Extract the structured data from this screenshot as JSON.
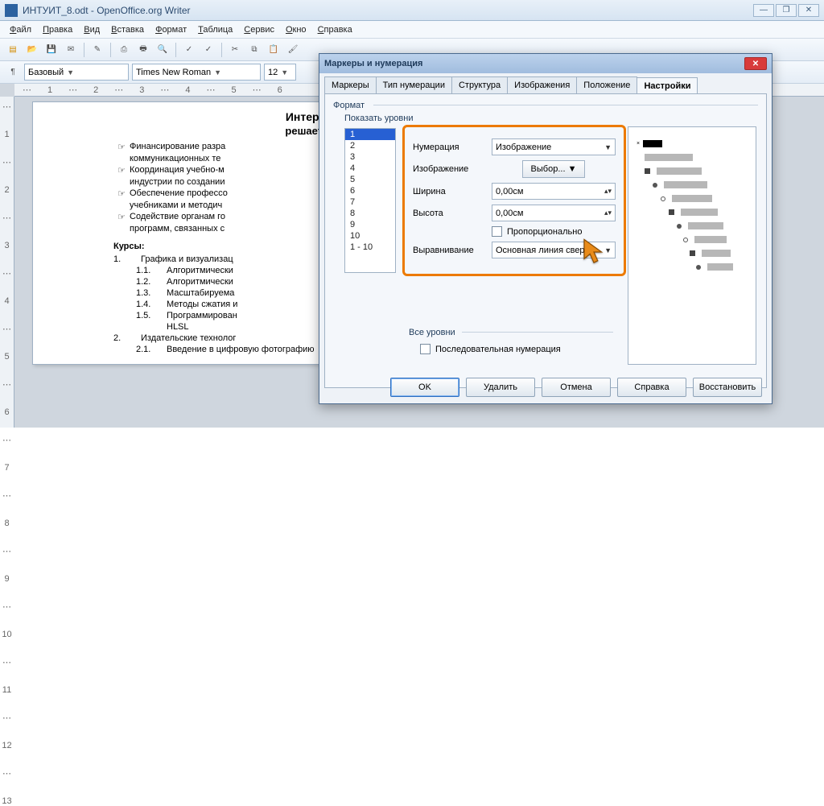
{
  "window": {
    "title": "ИНТУИТ_8.odt - OpenOffice.org Writer"
  },
  "menu": {
    "file": "Файл",
    "edit": "Правка",
    "view": "Вид",
    "insert": "Вставка",
    "format": "Формат",
    "table": "Таблица",
    "tools": "Сервис",
    "window": "Окно",
    "help": "Справка"
  },
  "toolbar2": {
    "style": "Базовый",
    "font": "Times New Roman",
    "size": "12"
  },
  "ruler_h": [
    "⋯",
    "1",
    "⋯",
    "2",
    "⋯",
    "3",
    "⋯",
    "4",
    "⋯",
    "5",
    "⋯",
    "6"
  ],
  "ruler_v": [
    "⋯",
    "1",
    "⋯",
    "2",
    "⋯",
    "3",
    "⋯",
    "4",
    "⋯",
    "5",
    "⋯",
    "6",
    "⋯",
    "7",
    "⋯",
    "8",
    "⋯",
    "9",
    "⋯",
    "10",
    "⋯",
    "11",
    "⋯",
    "12",
    "⋯",
    "13"
  ],
  "doc": {
    "h1": "Интернет-Университе",
    "h2": "решает следующие зад",
    "bullets": [
      "Финансирование разра",
      "коммуникационных те",
      "Координация учебно-м",
      "индустрии по создании",
      "Обеспечение профессо",
      "учебниками и методич",
      "Содействие органам го",
      "программ, связанных с"
    ],
    "kursy": "Курсы:",
    "nums": [
      {
        "n": "1.",
        "t": "Графика и визуализац"
      },
      {
        "n": "1.1.",
        "t": "Алгоритмически"
      },
      {
        "n": "1.2.",
        "t": "Алгоритмически"
      },
      {
        "n": "1.3.",
        "t": "Масштабируема"
      },
      {
        "n": "1.4.",
        "t": "Методы сжатия и"
      },
      {
        "n": "1.5.",
        "t": "Программирован"
      },
      {
        "n": "",
        "t": "HLSL"
      },
      {
        "n": "2.",
        "t": "Издательские технолог"
      },
      {
        "n": "2.1.",
        "t": "Введение в цифровую фотографию"
      }
    ],
    "bullet_glyph": "☞"
  },
  "dialog": {
    "title": "Маркеры и нумерация",
    "tabs": [
      "Маркеры",
      "Тип нумерации",
      "Структура",
      "Изображения",
      "Положение",
      "Настройки"
    ],
    "active_tab": 5,
    "format_label": "Формат",
    "show_levels_label": "Показать уровни",
    "levels": [
      "1",
      "2",
      "3",
      "4",
      "5",
      "6",
      "7",
      "8",
      "9",
      "10",
      "1 - 10"
    ],
    "selected_level": 0,
    "rows": {
      "numbering_label": "Нумерация",
      "numbering_value": "Изображение",
      "image_label": "Изображение",
      "image_button": "Выбор...",
      "width_label": "Ширина",
      "width_value": "0,00см",
      "height_label": "Высота",
      "height_value": "0,00см",
      "proportional_label": "Пропорционально",
      "align_label": "Выравнивание",
      "align_value": "Основная линия свер"
    },
    "all_levels_label": "Все уровни",
    "sequential_label": "Последовательная нумерация",
    "buttons": {
      "ok": "OK",
      "delete": "Удалить",
      "cancel": "Отмена",
      "help": "Справка",
      "restore": "Восстановить"
    }
  }
}
